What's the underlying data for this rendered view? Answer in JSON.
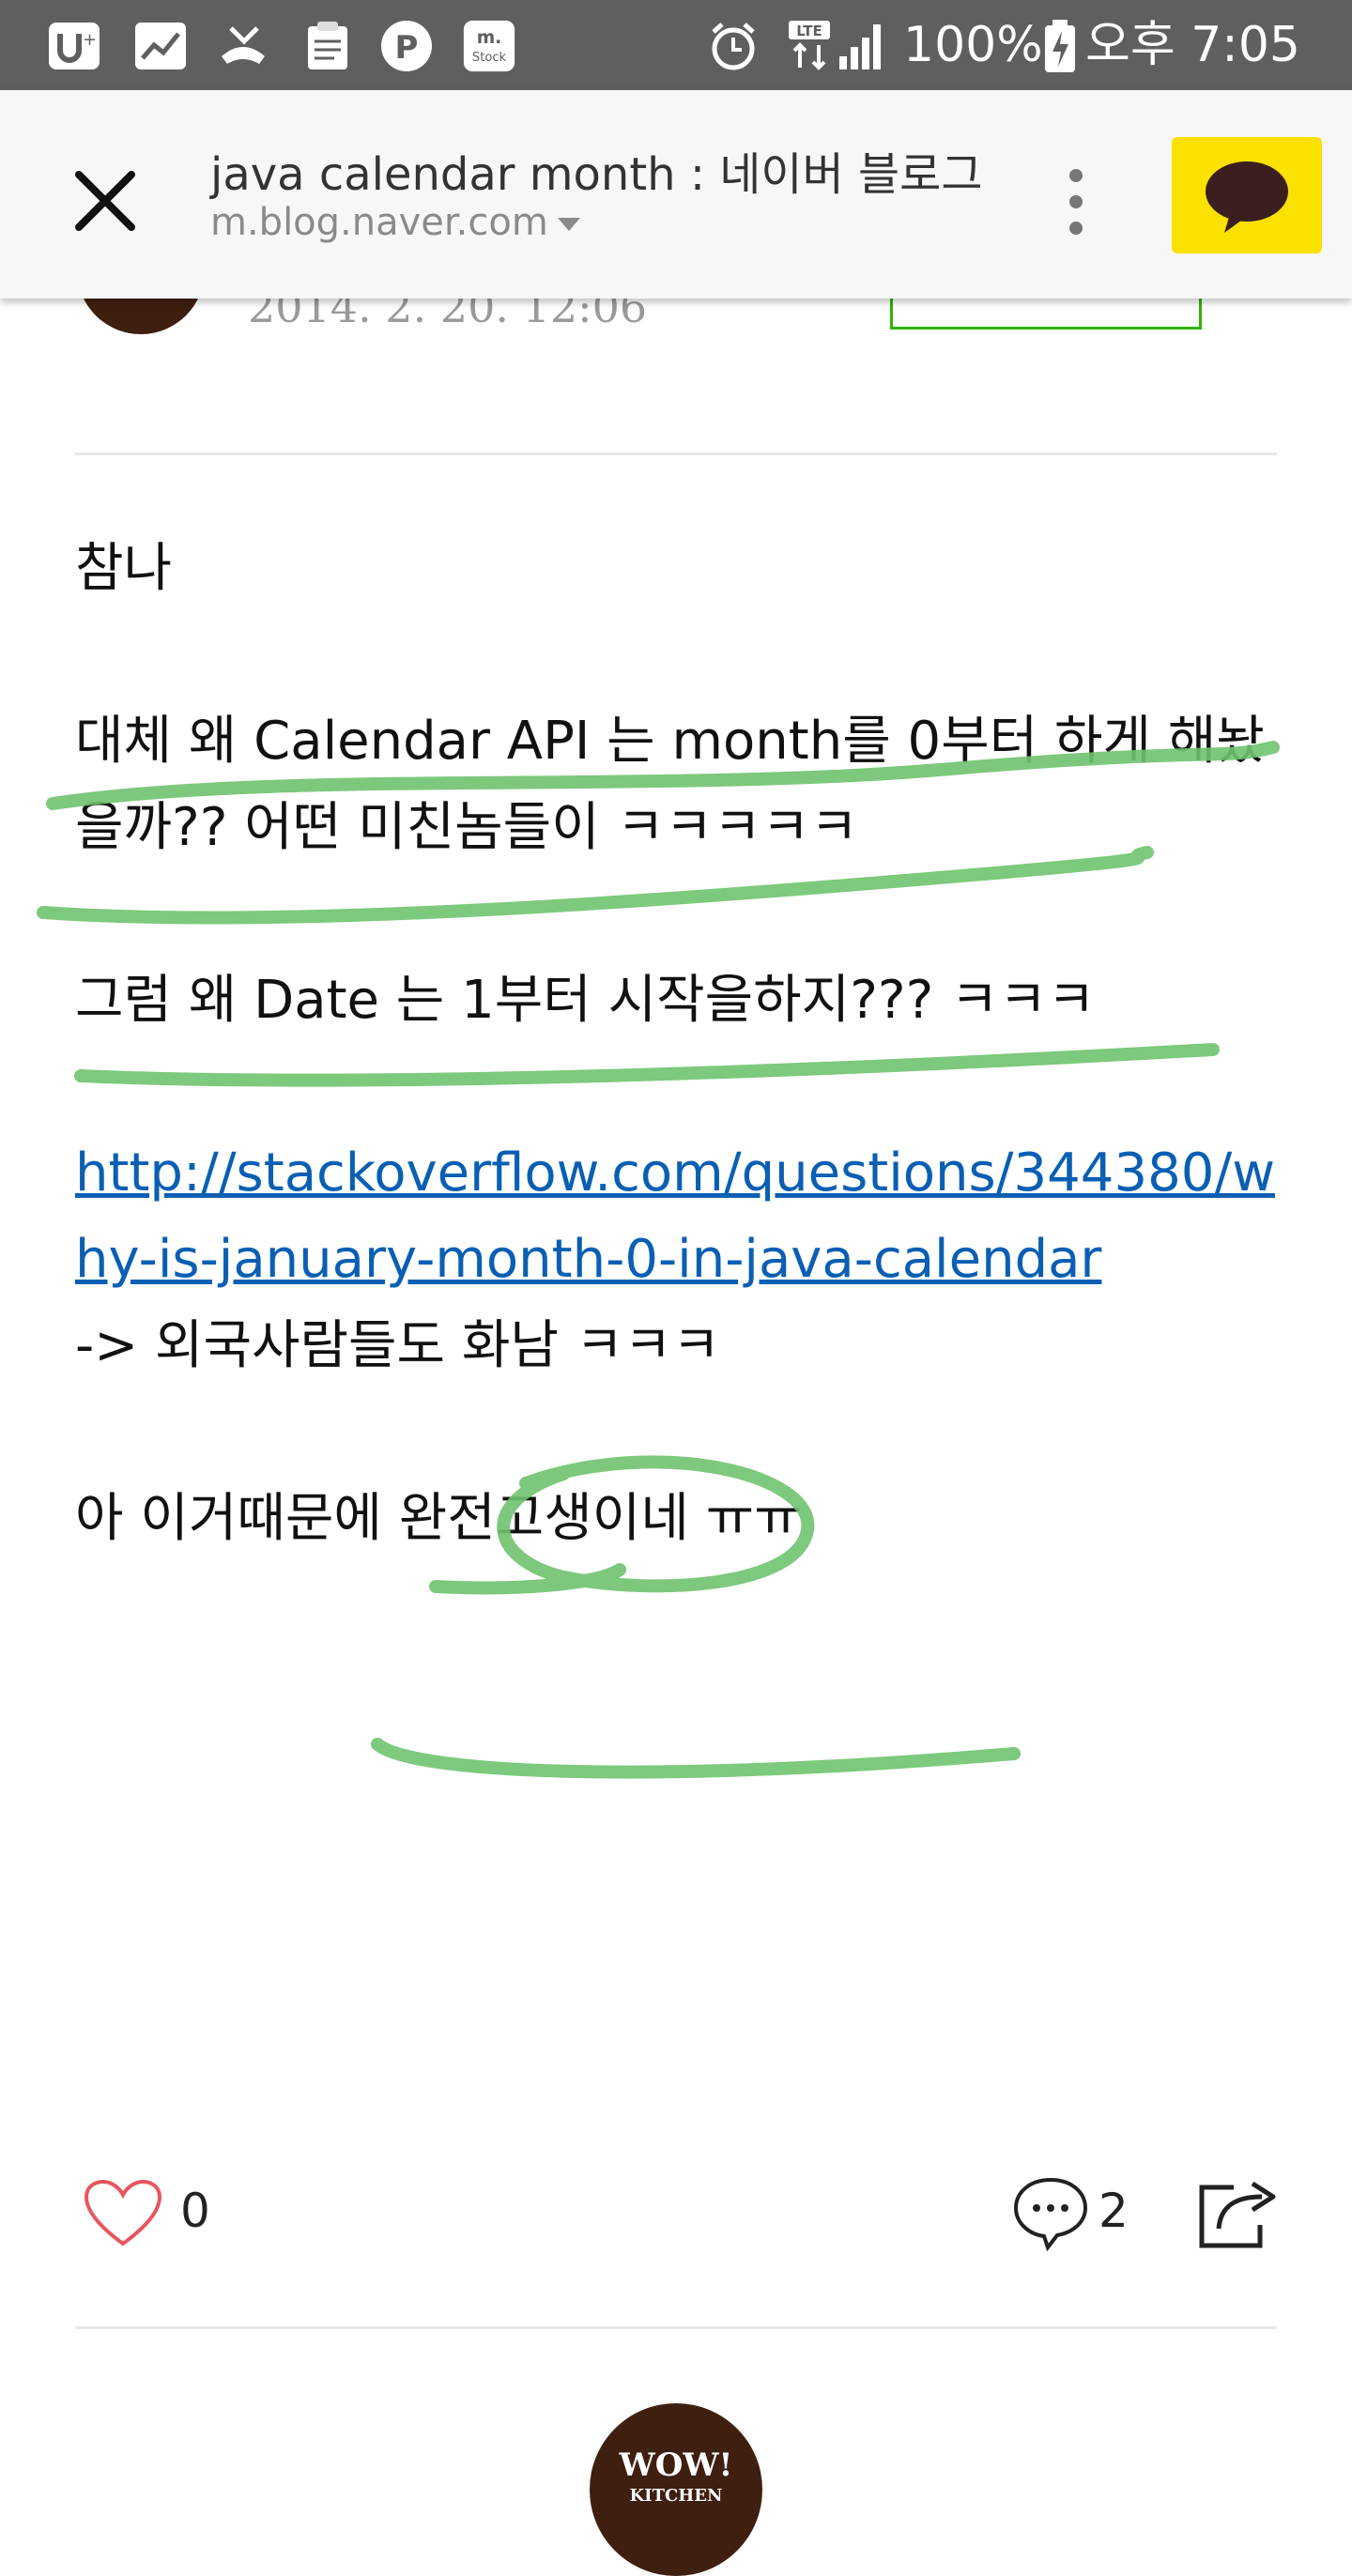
{
  "status_bar": {
    "battery_percent": "100%",
    "network": "LTE",
    "time": "오후 7:05",
    "left_icons": [
      "uplus-icon",
      "stock-chart-icon",
      "missed-call-icon",
      "clipboard-icon",
      "p-app-icon",
      "m-stock-icon"
    ],
    "m_stock_label": "m.\nStock"
  },
  "browser": {
    "title": "java calendar month : 네이버 블로그",
    "url": "m.blog.naver.com"
  },
  "post": {
    "date": "2014. 2. 20. 12:06",
    "lines": {
      "l1": "참나",
      "l2": "대체 왜 Calendar API 는 month를 0부터 하게 해놨을까?? 어떤 미친놈들이 ㅋㅋㅋㅋㅋ",
      "l3": "그럼 왜 Date 는 1부터 시작을하지??? ㅋㅋㅋ",
      "link": "http://stackoverflow.com/questions/344380/why-is-january-month-0-in-java-calendar",
      "l4": "-> 외국사람들도 화남 ㅋㅋㅋ",
      "l5": "아 이거때문에 완전고생이네 ㅠㅠ"
    }
  },
  "actions": {
    "like_count": "0",
    "comment_count": "2"
  },
  "blog_logo": {
    "line1": "WOW!",
    "line2": "KITCHEN"
  },
  "colors": {
    "status_bar": "#5f5f5f",
    "kakao_yellow": "#fae100",
    "annotation_green": "#6fc36f",
    "link_blue": "#0a5fb4",
    "follow_green": "#2db400",
    "heart_red": "#e8555e"
  }
}
